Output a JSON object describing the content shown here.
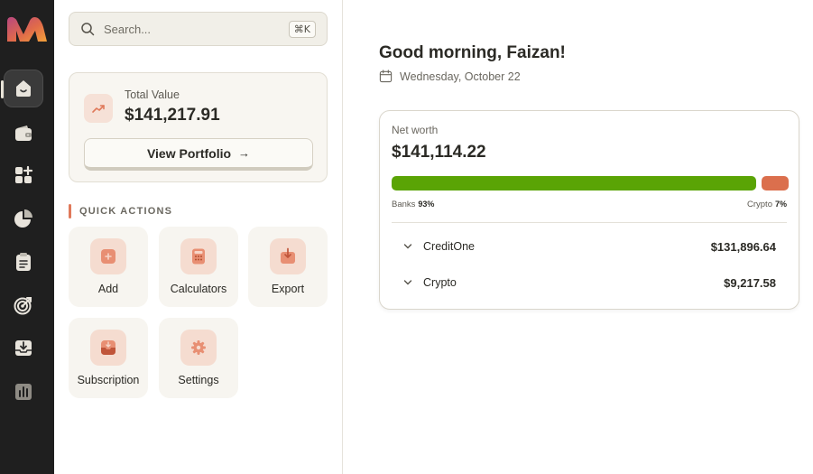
{
  "rail": {
    "logo": "app-logo",
    "items": [
      {
        "icon": "home-icon",
        "active": true
      },
      {
        "icon": "wallet-icon",
        "active": false
      },
      {
        "icon": "apps-add-icon",
        "active": false
      },
      {
        "icon": "pie-chart-icon",
        "active": false
      },
      {
        "icon": "clipboard-icon",
        "active": false
      },
      {
        "icon": "target-icon",
        "active": false
      },
      {
        "icon": "download-tray-icon",
        "active": false
      },
      {
        "icon": "bar-chart-icon",
        "active": false
      }
    ]
  },
  "search": {
    "placeholder": "Search...",
    "shortcut": "⌘K"
  },
  "total": {
    "label": "Total Value",
    "value": "$141,217.91",
    "button": "View Portfolio",
    "button_icon": "→"
  },
  "quick_actions": {
    "title": "QUICK ACTIONS",
    "items": [
      {
        "label": "Add",
        "icon": "plus-square-icon"
      },
      {
        "label": "Calculators",
        "icon": "calculator-icon"
      },
      {
        "label": "Export",
        "icon": "export-icon"
      },
      {
        "label": "Subscription",
        "icon": "subscription-icon"
      },
      {
        "label": "Settings",
        "icon": "gear-icon"
      }
    ]
  },
  "main": {
    "greeting": "Good morning, Faizan!",
    "date": "Wednesday, October 22"
  },
  "net_worth": {
    "label": "Net worth",
    "value": "$141,114.22",
    "allocation": [
      {
        "name": "Banks",
        "percent": 93,
        "percent_label": "93%",
        "color": "#5aa405"
      },
      {
        "name": "Crypto",
        "percent": 7,
        "percent_label": "7%",
        "color": "#db6f4d"
      }
    ],
    "accounts": [
      {
        "name": "CreditOne",
        "value": "$131,896.64"
      },
      {
        "name": "Crypto",
        "value": "$9,217.58"
      }
    ]
  },
  "colors": {
    "accent": "#e0795a",
    "rail_bg": "#1f1f1f",
    "tile_icon_bg": "#f5dcd0"
  }
}
